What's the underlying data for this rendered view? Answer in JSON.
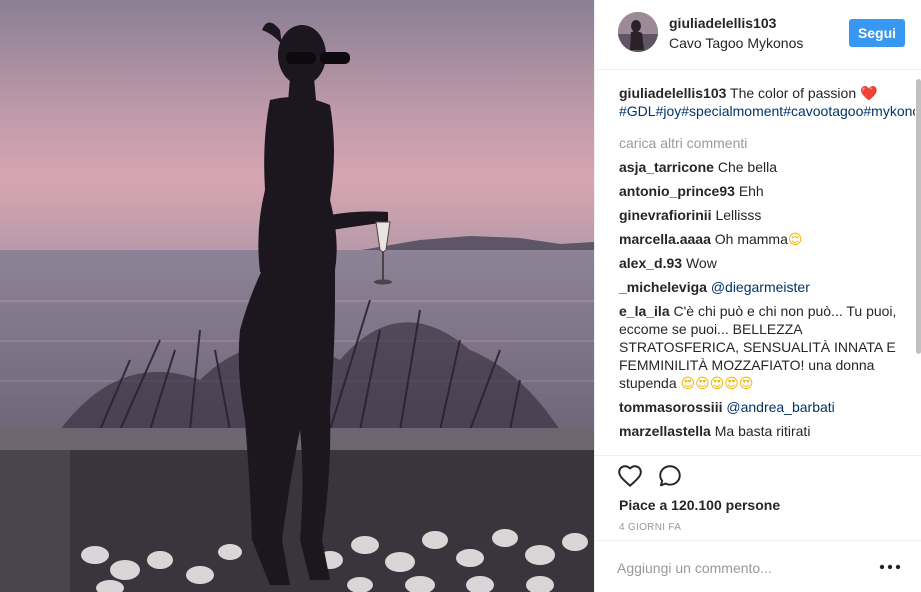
{
  "post": {
    "username": "giuliadelellis103",
    "location": "Cavo Tagoo Mykonos",
    "follow_label": "Segui",
    "caption_user": "giuliadelellis103",
    "caption_text": "The color of passion",
    "caption_heart": "❤️",
    "caption_tags": "#GDL#joy#specialmoment#cavootagoo#mykonos#grace#travel#passion#loveit",
    "load_more": "carica altri commenti",
    "likes": "Piace a 120.100 persone",
    "time": "4 GIORNI FA",
    "add_comment_placeholder": "Aggiungi un commento..."
  },
  "comments": [
    {
      "user": "asja_tarricone",
      "text": "Che bella"
    },
    {
      "user": "antonio_prince93",
      "text": "Ehh"
    },
    {
      "user": "ginevrafiorinii",
      "text": "Lellisss"
    },
    {
      "user": "marcella.aaaa",
      "text": "Oh mamma",
      "emoji": "😌"
    },
    {
      "user": "alex_d.93",
      "text": "Wow"
    },
    {
      "user": "_micheleviga",
      "mention": "@diegarmeister"
    },
    {
      "user": "e_la_ila",
      "text": "C'è chi può e chi non può... Tu puoi, eccome se puoi... BELLEZZA STRATOSFERICA, SENSUALITÀ INNATA E FEMMINILITÀ MOZZAFIATO! una donna stupenda",
      "emoji": "😍😍😍😍😍"
    },
    {
      "user": "tommasorossiii",
      "mention": "@andrea_barbati"
    },
    {
      "user": "marzellastella",
      "text": "Ma basta ritirati"
    }
  ],
  "icons": {
    "like": "heart-outline-icon",
    "comment": "speech-bubble-icon",
    "more": "more-options-icon"
  },
  "colors": {
    "follow_button": "#3897f0",
    "hashtag": "#003569",
    "muted": "#999999"
  }
}
